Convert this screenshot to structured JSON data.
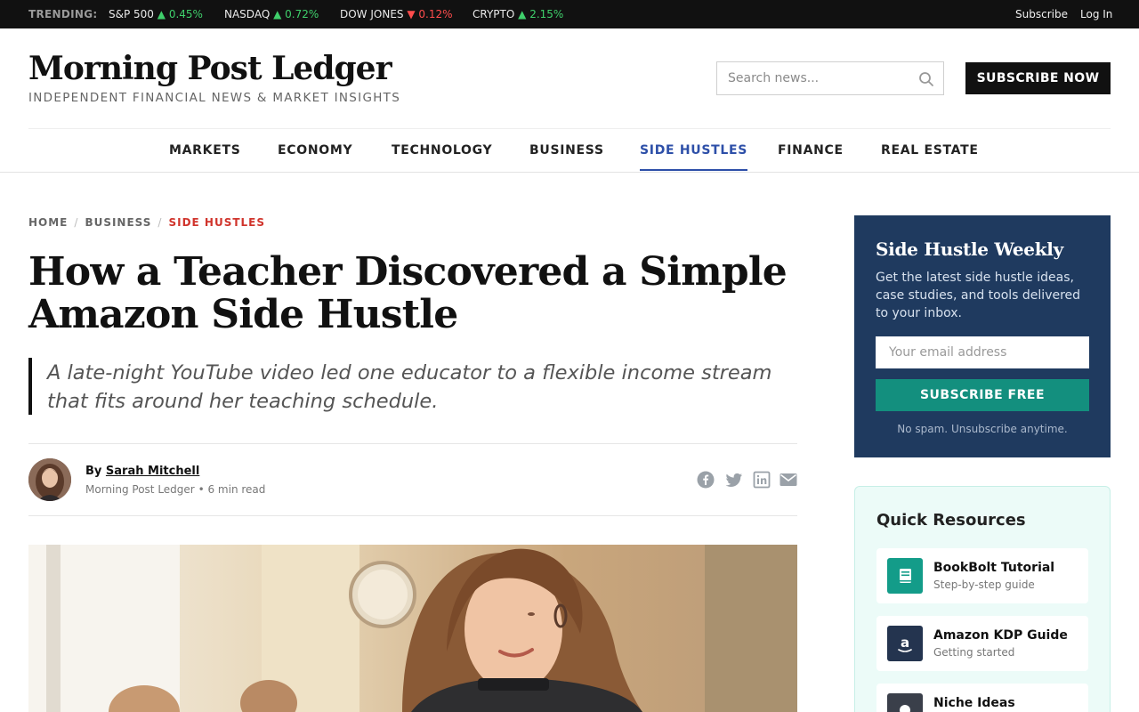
{
  "topbar": {
    "trending_label": "TRENDING:",
    "tickers": [
      {
        "name": "S&P 500",
        "arrow": "▲",
        "change": "0.45%",
        "direction": "up"
      },
      {
        "name": "NASDAQ",
        "arrow": "▲",
        "change": "0.72%",
        "direction": "up"
      },
      {
        "name": "DOW JONES",
        "arrow": "▼",
        "change": "0.12%",
        "direction": "down"
      },
      {
        "name": "CRYPTO",
        "arrow": "▲",
        "change": "2.15%",
        "direction": "up"
      }
    ],
    "subscribe_link": "Subscribe",
    "login_link": "Log In"
  },
  "header": {
    "site_name": "Morning Post Ledger",
    "tagline": "INDEPENDENT FINANCIAL NEWS & MARKET INSIGHTS",
    "search_placeholder": "Search news...",
    "subscribe_button": "SUBSCRIBE NOW"
  },
  "nav": {
    "items": [
      "MARKETS",
      "ECONOMY",
      "TECHNOLOGY",
      "BUSINESS",
      "SIDE HUSTLES",
      "FINANCE",
      "REAL ESTATE"
    ],
    "active": "SIDE HUSTLES"
  },
  "breadcrumb": {
    "items": [
      "HOME",
      "BUSINESS",
      "SIDE HUSTLES"
    ],
    "separator": "/"
  },
  "article": {
    "headline": "How a Teacher Discovered a Simple Amazon Side Hustle",
    "dek": "A late-night YouTube video led one educator to a flexible income stream that fits around her teaching schedule.",
    "byline_prefix": "By",
    "author": "Sarah Mitchell",
    "publication": "Morning Post Ledger",
    "meta_separator": "•",
    "read_time": "6 min read",
    "share_icons": [
      "facebook-icon",
      "twitter-icon",
      "linkedin-icon",
      "email-icon"
    ]
  },
  "sidebar": {
    "newsletter": {
      "title": "Side Hustle Weekly",
      "description": "Get the latest side hustle ideas, case studies, and tools delivered to your inbox.",
      "email_placeholder": "Your email address",
      "button": "SUBSCRIBE FREE",
      "note": "No spam. Unsubscribe anytime."
    },
    "resources": {
      "title": "Quick Resources",
      "items": [
        {
          "name": "BookBolt Tutorial",
          "subtitle": "Step-by-step guide",
          "icon": "book-icon",
          "color": "#139c89"
        },
        {
          "name": "Amazon KDP Guide",
          "subtitle": "Getting started",
          "icon": "amazon-icon",
          "color": "#24344f"
        },
        {
          "name": "Niche Ideas",
          "subtitle": "",
          "icon": "lightbulb-icon",
          "color": "#3a3f4a"
        }
      ]
    }
  },
  "colors": {
    "accent_blue": "#2d4fa8",
    "breadcrumb_red": "#d0342c",
    "newsletter_bg": "#1f3a5f",
    "cta_teal": "#138f7e",
    "ticker_up": "#3fcf6b",
    "ticker_down": "#ff4d4d"
  }
}
